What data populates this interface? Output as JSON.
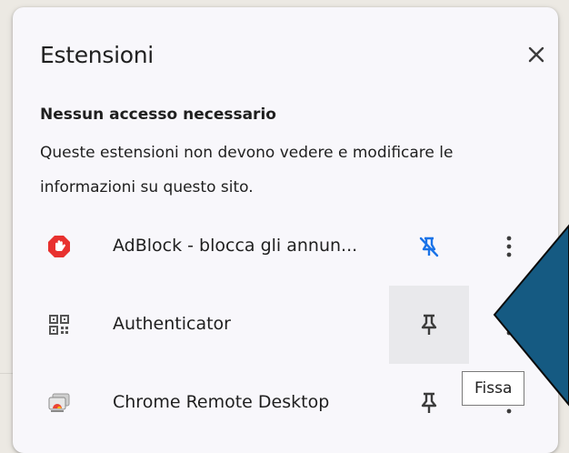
{
  "panel": {
    "title": "Estensioni",
    "close_icon": "close-icon"
  },
  "section": {
    "heading": "Nessun accesso necessario",
    "description": "Queste estensioni non devono vedere e modificare le informazioni su questo sito."
  },
  "extensions": [
    {
      "name": "AdBlock - blocca gli annun...",
      "icon": "adblock-icon",
      "pin_state": "pinned",
      "pin_icon": "unpin-icon"
    },
    {
      "name": "Authenticator",
      "icon": "authenticator-icon",
      "pin_state": "unpinned",
      "pin_icon": "pin-icon"
    },
    {
      "name": "Chrome Remote Desktop",
      "icon": "chrome-remote-desktop-icon",
      "pin_state": "unpinned",
      "pin_icon": "pin-icon"
    }
  ],
  "tooltip": {
    "text": "Fissa"
  },
  "colors": {
    "accent": "#1a73e8",
    "annotation_fill": "#155a82",
    "adblock_red": "#e8312f"
  }
}
